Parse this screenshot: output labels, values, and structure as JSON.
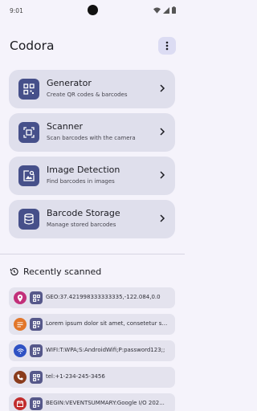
{
  "status": {
    "time": "9:01"
  },
  "app": {
    "title": "Codora",
    "menu_icon": "more-vert-icon"
  },
  "cards": [
    {
      "title": "Generator",
      "subtitle": "Create QR codes & barcodes",
      "icon": "qr-code-icon"
    },
    {
      "title": "Scanner",
      "subtitle": "Scan barcodes with the camera",
      "icon": "scan-icon"
    },
    {
      "title": "Image Detection",
      "subtitle": "Find barcodes in images",
      "icon": "image-search-icon"
    },
    {
      "title": "Barcode Storage",
      "subtitle": "Manage stored barcodes",
      "icon": "database-icon"
    }
  ],
  "recent": {
    "title": "Recently scanned",
    "items": [
      {
        "type": "location",
        "color": "#c2307a",
        "text": "GEO:37.421998333333335,-122.084,0.0"
      },
      {
        "type": "text",
        "color": "#e2762a",
        "text": "Lorem ipsum dolor sit amet, consetetur sa..."
      },
      {
        "type": "wifi",
        "color": "#2f52c4",
        "text": "WIFI:T:WPA;S:AndroidWifi;P:password123;;"
      },
      {
        "type": "phone",
        "color": "#8a3c1c",
        "text": "tel:+1-234-245-3456"
      },
      {
        "type": "calendar",
        "color": "#c22d2d",
        "text": "BEGIN:VEVENTSUMMARY:Google I/O 202..."
      }
    ]
  },
  "colors": {
    "background": "#f5f3fb",
    "card": "#dfdfec",
    "accent": "#46508a",
    "item": "#e4e3ee"
  }
}
